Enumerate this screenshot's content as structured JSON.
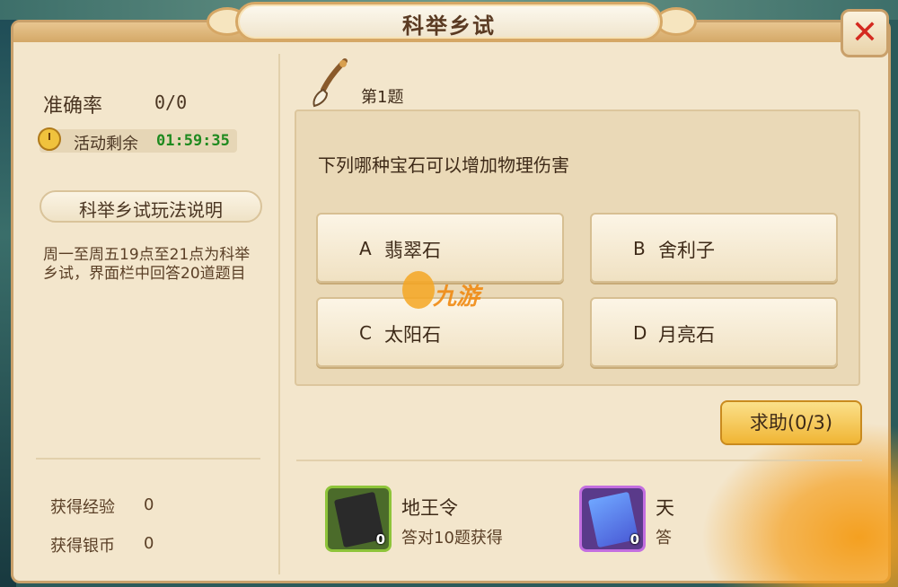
{
  "window": {
    "title": "科举乡试",
    "close_label": "✕"
  },
  "stats": {
    "accuracy_label": "准确率",
    "accuracy_value": "0/0",
    "timer_label": "活动剩余",
    "timer_value": "01:59:35"
  },
  "rules": {
    "title": "科举乡试玩法说明",
    "text": "周一至周五19点至21点为科举乡试，界面栏中回答20道题目"
  },
  "earnings": {
    "exp_label": "获得经验",
    "exp_value": "0",
    "silver_label": "获得银币",
    "silver_value": "0"
  },
  "question": {
    "number": "第1题",
    "text": "下列哪种宝石可以增加物理伤害",
    "options": [
      {
        "letter": "A",
        "text": "翡翠石"
      },
      {
        "letter": "B",
        "text": "舍利子"
      },
      {
        "letter": "C",
        "text": "太阳石"
      },
      {
        "letter": "D",
        "text": "月亮石"
      }
    ]
  },
  "help_button": {
    "label": "求助(0/3)"
  },
  "rewards": [
    {
      "name": "地王令",
      "desc": "答对10题获得",
      "count": "0",
      "icon": "black-scroll-icon",
      "border_color": "#8ec43a"
    },
    {
      "name": "天",
      "desc": "答",
      "count": "0",
      "icon": "blue-scroll-icon",
      "border_color": "#c36ee0"
    }
  ],
  "watermark": {
    "text": "九游"
  },
  "colors": {
    "panel": "#f3e6cc",
    "accent": "#c9a06a",
    "timer": "#1f8a1f",
    "close": "#d42a20"
  }
}
